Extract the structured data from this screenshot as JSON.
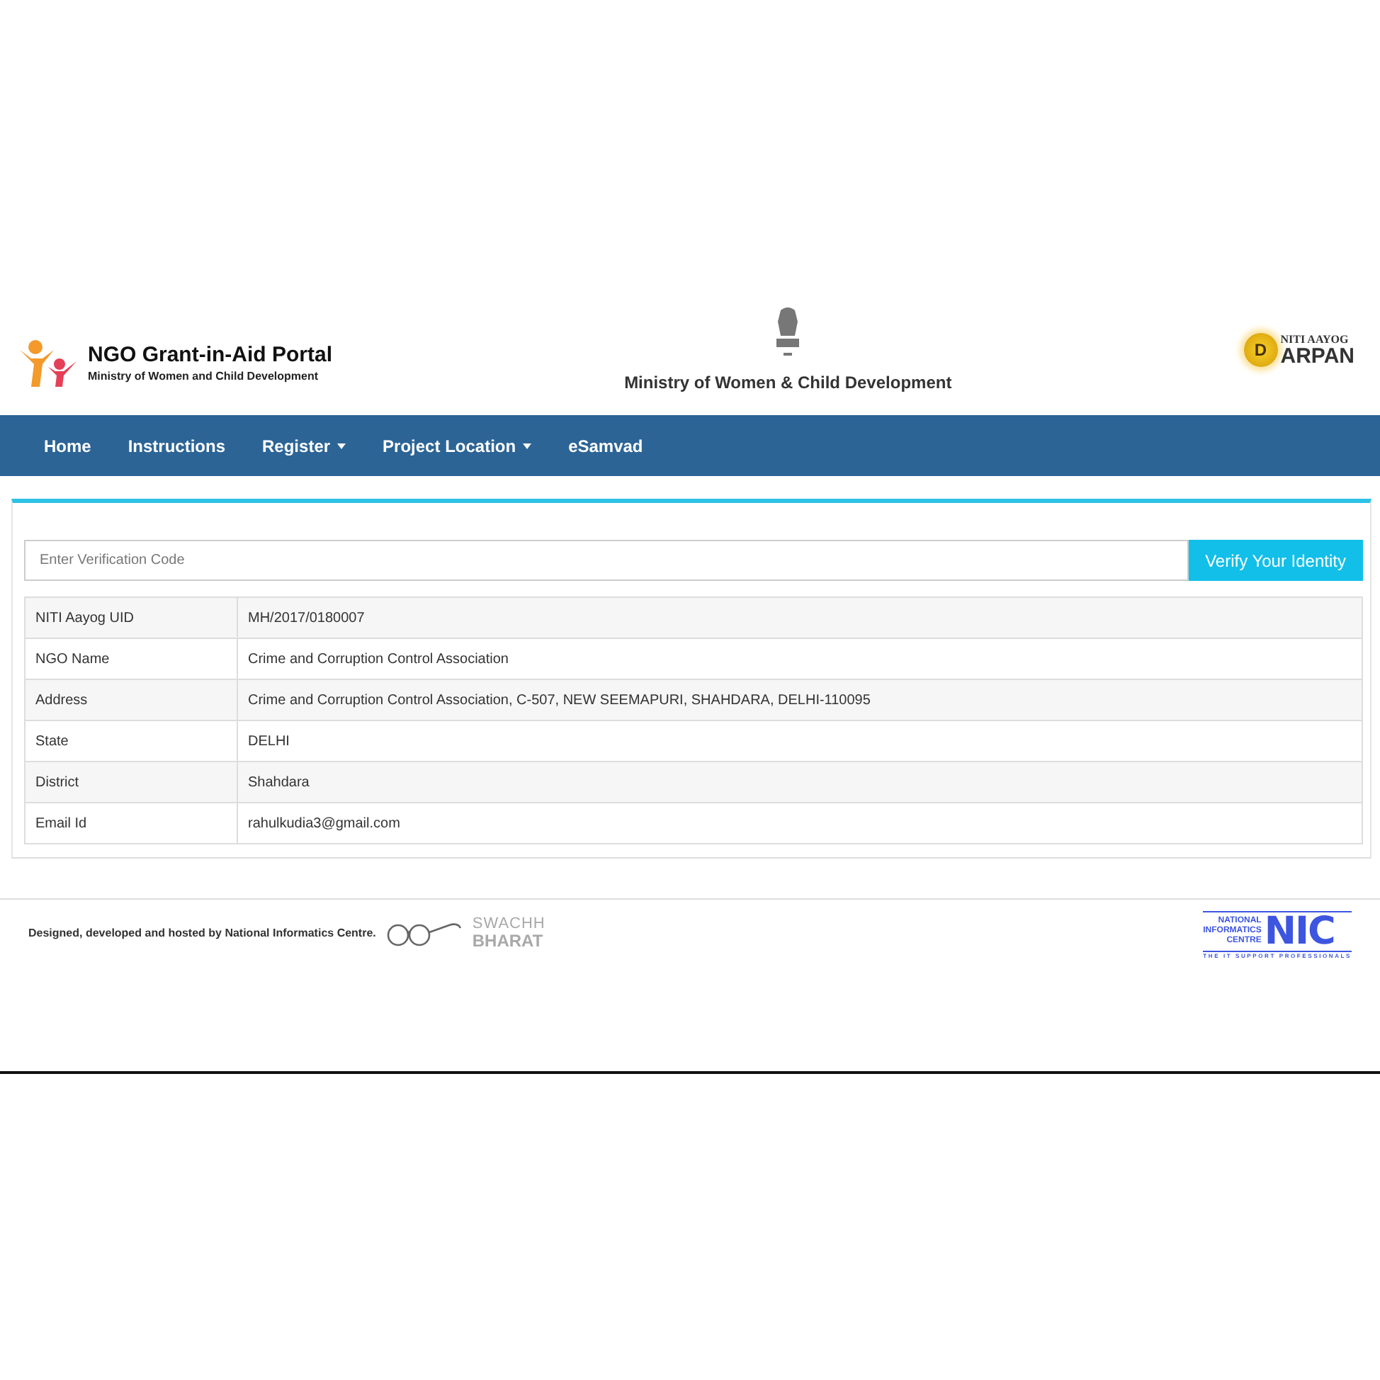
{
  "header": {
    "portal_title": "NGO Grant-in-Aid Portal",
    "portal_subtitle": "Ministry of Women and Child Development",
    "ministry": "Ministry of Women & Child Development",
    "darpan": {
      "top": "NITI AAYOG",
      "letter": "D",
      "name": "ARPAN"
    }
  },
  "nav": [
    {
      "label": "Home",
      "dropdown": false
    },
    {
      "label": "Instructions",
      "dropdown": false
    },
    {
      "label": "Register",
      "dropdown": true
    },
    {
      "label": "Project Location",
      "dropdown": true
    },
    {
      "label": "eSamvad",
      "dropdown": false
    }
  ],
  "verify": {
    "placeholder": "Enter Verification Code",
    "button": "Verify Your Identity"
  },
  "details": [
    {
      "label": "NITI Aayog UID",
      "value": "MH/2017/0180007"
    },
    {
      "label": "NGO Name",
      "value": "Crime and Corruption Control Association"
    },
    {
      "label": "Address",
      "value": "Crime and Corruption Control Association, C-507, NEW SEEMAPURI, SHAHDARA, DELHI-110095"
    },
    {
      "label": "State",
      "value": "DELHI"
    },
    {
      "label": "District",
      "value": "Shahdara"
    },
    {
      "label": "Email Id",
      "value": "rahulkudia3@gmail.com"
    }
  ],
  "footer": {
    "credit": "Designed, developed and hosted by National Informatics Centre.",
    "swachh_top": "SWACHH",
    "swachh_bottom": "BHARAT",
    "nic": {
      "lines": [
        "NATIONAL",
        "INFORMATICS",
        "CENTRE"
      ],
      "mark": "NIC",
      "tagline": "THE IT SUPPORT PROFESSIONALS"
    }
  }
}
